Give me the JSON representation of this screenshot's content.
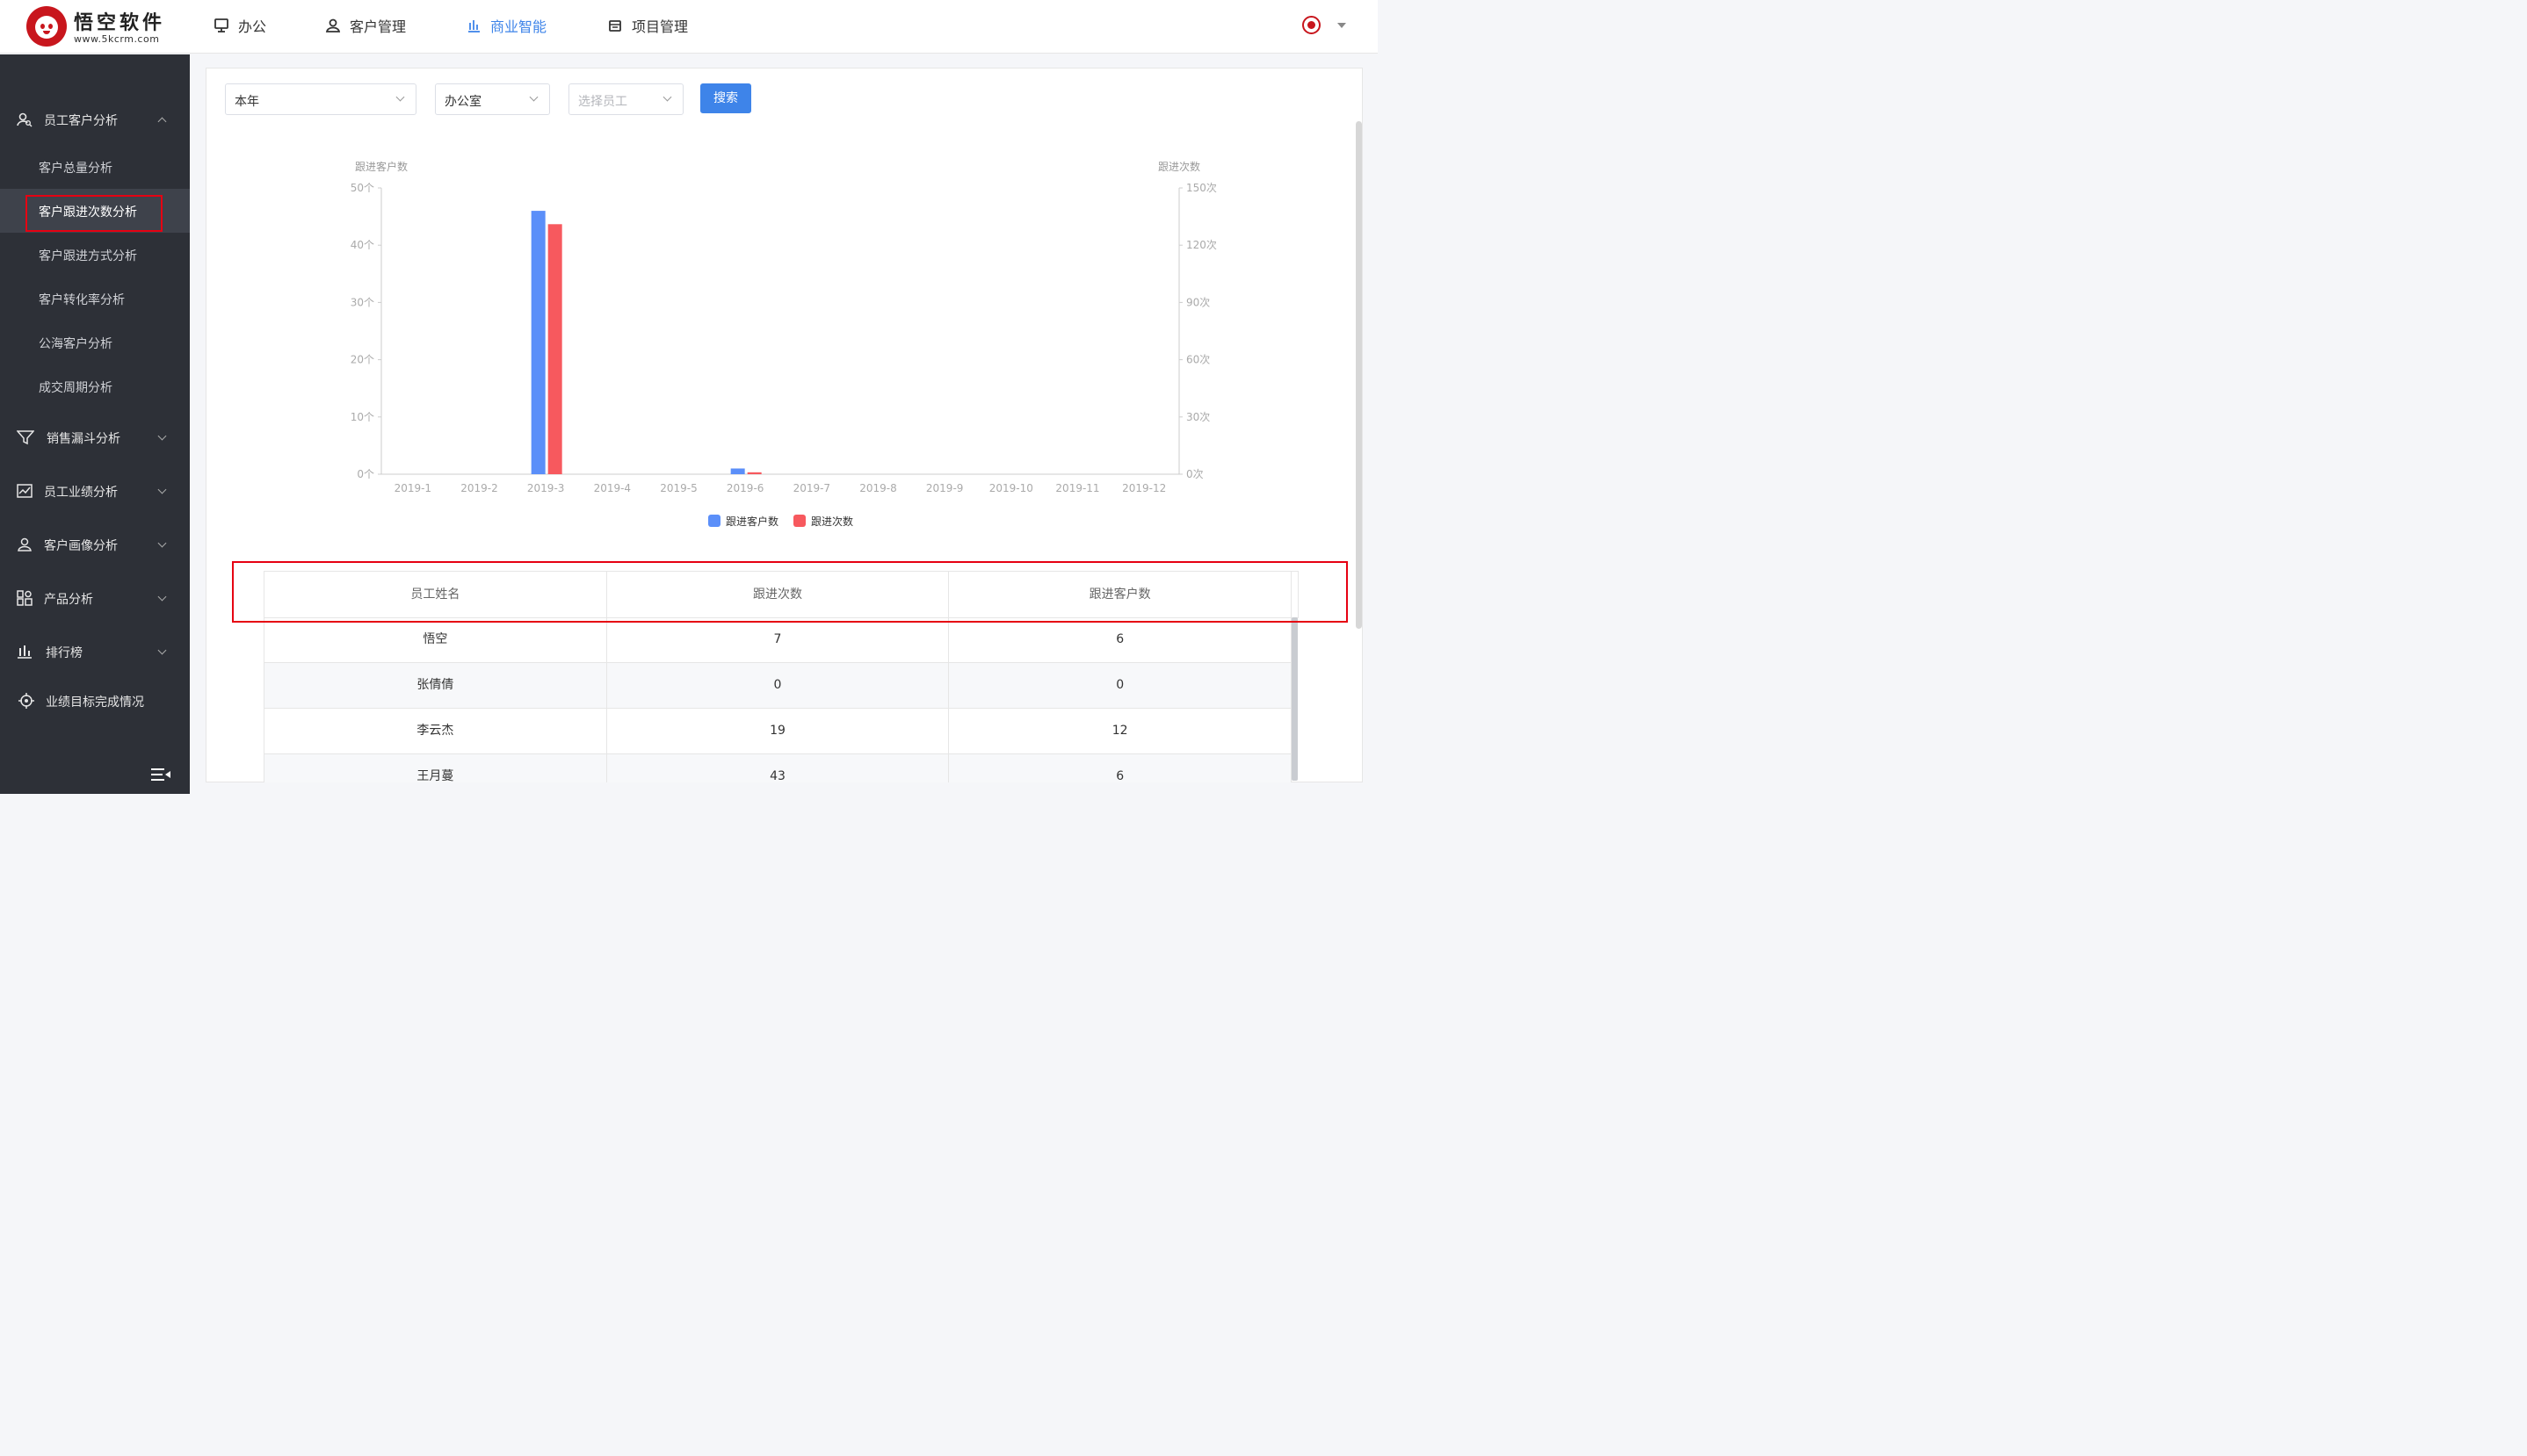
{
  "app": {
    "logo_name": "悟空软件",
    "logo_url": "www.5kcrm.com"
  },
  "nav": [
    {
      "label": "办公",
      "icon": "monitor-icon",
      "active": false
    },
    {
      "label": "客户管理",
      "icon": "user-icon",
      "active": false
    },
    {
      "label": "商业智能",
      "icon": "bar-chart-icon",
      "active": true
    },
    {
      "label": "项目管理",
      "icon": "box-icon",
      "active": false
    }
  ],
  "sidebar": {
    "groups": [
      {
        "label": "员工客户分析",
        "icon": "user-search-icon",
        "expanded": true
      },
      {
        "label": "销售漏斗分析",
        "icon": "funnel-icon",
        "expanded": false
      },
      {
        "label": "员工业绩分析",
        "icon": "line-chart-icon",
        "expanded": false
      },
      {
        "label": "客户画像分析",
        "icon": "portrait-icon",
        "expanded": false
      },
      {
        "label": "产品分析",
        "icon": "grid-icon",
        "expanded": false
      },
      {
        "label": "排行榜",
        "icon": "ranking-icon",
        "expanded": false
      },
      {
        "label": "业绩目标完成情况",
        "icon": "target-icon",
        "expanded": false
      }
    ],
    "sub_items": [
      {
        "label": "客户总量分析",
        "active": false
      },
      {
        "label": "客户跟进次数分析",
        "active": true
      },
      {
        "label": "客户跟进方式分析",
        "active": false
      },
      {
        "label": "客户转化率分析",
        "active": false
      },
      {
        "label": "公海客户分析",
        "active": false
      },
      {
        "label": "成交周期分析",
        "active": false
      }
    ]
  },
  "filters": {
    "period": "本年",
    "department": "办公室",
    "employee_placeholder": "选择员工",
    "search_label": "搜索"
  },
  "chart_data": {
    "type": "bar",
    "categories": [
      "2019-1",
      "2019-2",
      "2019-3",
      "2019-4",
      "2019-5",
      "2019-6",
      "2019-7",
      "2019-8",
      "2019-9",
      "2019-10",
      "2019-11",
      "2019-12"
    ],
    "series": [
      {
        "name": "跟进客户数",
        "axis": "left",
        "color": "#5b8ff9",
        "values": [
          0,
          0,
          46,
          0,
          0,
          1,
          0,
          0,
          0,
          0,
          0,
          0
        ]
      },
      {
        "name": "跟进次数",
        "axis": "right",
        "color": "#f7595e",
        "values": [
          0,
          0,
          131,
          0,
          0,
          1,
          0,
          0,
          0,
          0,
          0,
          0
        ]
      }
    ],
    "ylabel_left": "跟进客户数",
    "ylabel_right": "跟进次数",
    "ylim_left": [
      0,
      50
    ],
    "ylim_right": [
      0,
      150
    ],
    "yticks_left": [
      "0个",
      "10个",
      "20个",
      "30个",
      "40个",
      "50个"
    ],
    "yticks_right": [
      "0次",
      "30次",
      "60次",
      "90次",
      "120次",
      "150次"
    ],
    "grid": false,
    "legend_position": "bottom-center"
  },
  "table": {
    "headers": [
      "员工姓名",
      "跟进次数",
      "跟进客户数"
    ],
    "rows": [
      [
        "悟空",
        "7",
        "6"
      ],
      [
        "张倩倩",
        "0",
        "0"
      ],
      [
        "李云杰",
        "19",
        "12"
      ],
      [
        "王月蔓",
        "43",
        "6"
      ]
    ]
  }
}
